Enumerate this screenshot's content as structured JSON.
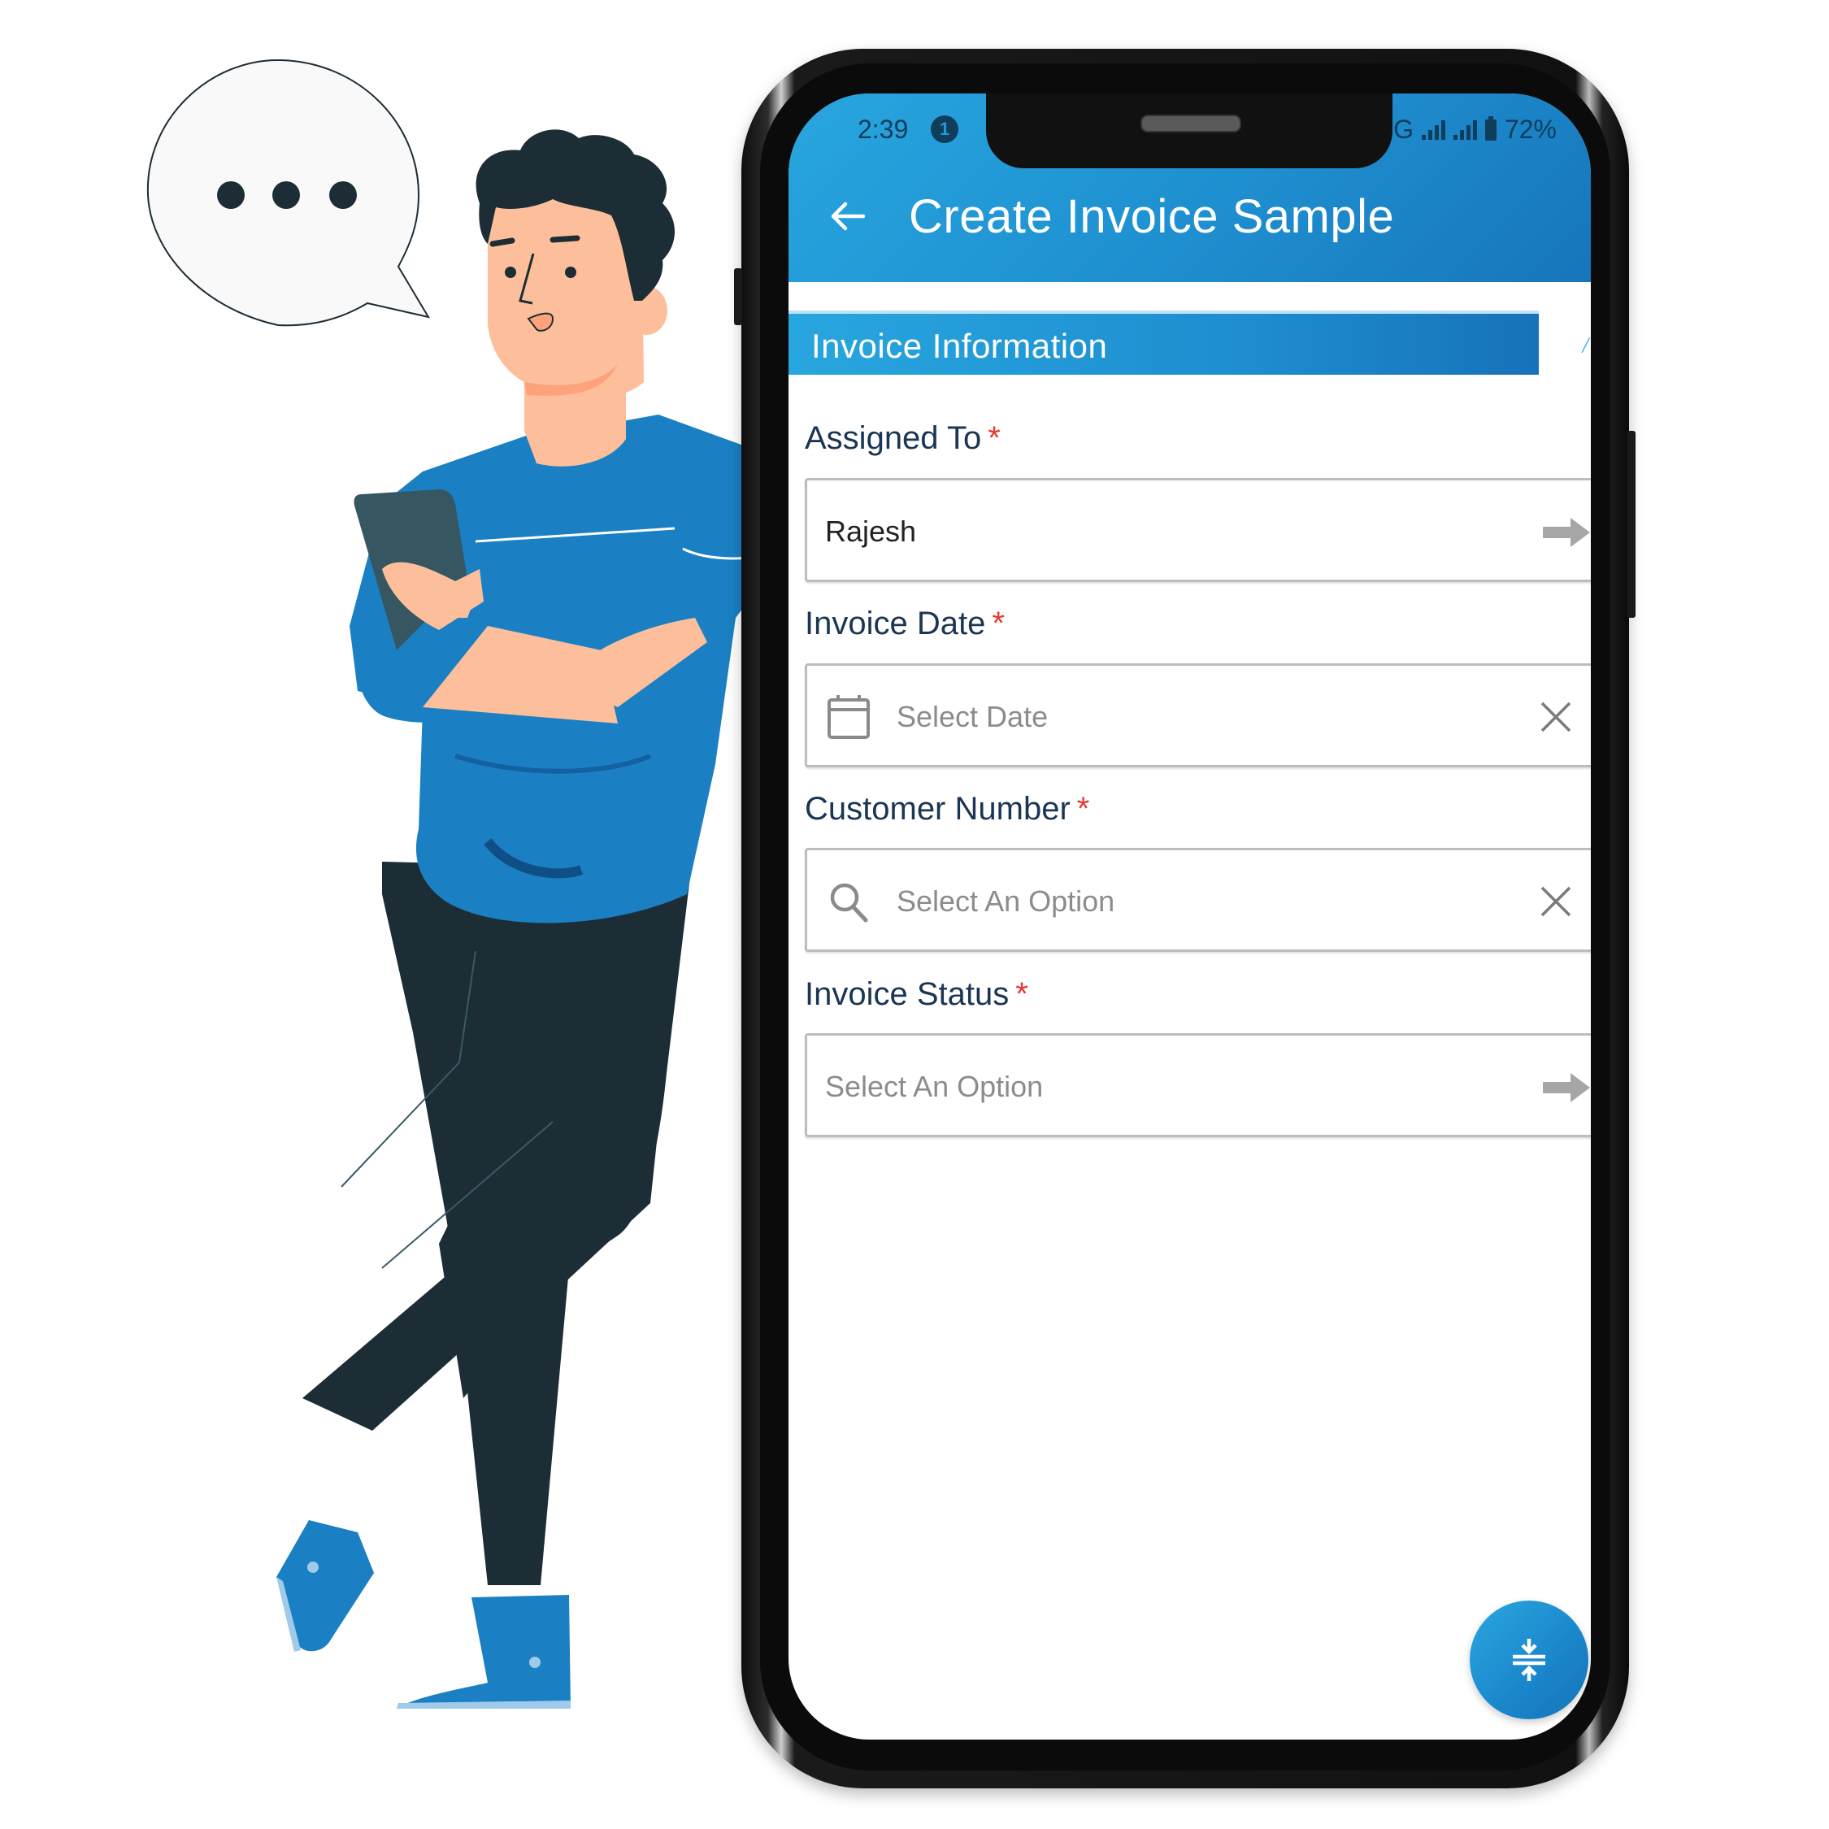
{
  "speech_bubble": {
    "icon": "ellipsis-icon",
    "dots": 3
  },
  "status_bar": {
    "time": "2:39",
    "notification_count": "1",
    "network_label": "G",
    "battery": "72%"
  },
  "app_bar": {
    "back_icon": "arrow-left-icon",
    "title": "Create Invoice Sample"
  },
  "section": {
    "title": "Invoice Information"
  },
  "form": {
    "fields": [
      {
        "label": "Assigned To",
        "required": "*",
        "value": "Rajesh",
        "placeholder": "",
        "left_icon": "",
        "right_icon": "arrow-right-icon"
      },
      {
        "label": "Invoice Date",
        "required": "*",
        "value": "",
        "placeholder": "Select Date",
        "left_icon": "calendar-icon",
        "right_icon": "close-icon"
      },
      {
        "label": "Customer Number",
        "required": "*",
        "value": "",
        "placeholder": "Select An Option",
        "left_icon": "search-icon",
        "right_icon": "close-icon"
      },
      {
        "label": "Invoice Status",
        "required": "*",
        "value": "",
        "placeholder": "Select An Option",
        "left_icon": "",
        "right_icon": "arrow-right-icon"
      }
    ]
  },
  "fab": {
    "icon": "collapse-vertical-icon"
  },
  "colors": {
    "primary": "#1e8fd0",
    "primary_light": "#28a6df",
    "primary_dark": "#1772b9",
    "label": "#1b3653",
    "required": "#e53935",
    "placeholder": "#8c8c8c",
    "shirt": "#1a80c3",
    "skin": "#fdbf9b",
    "hair_pants": "#1c2d35"
  }
}
